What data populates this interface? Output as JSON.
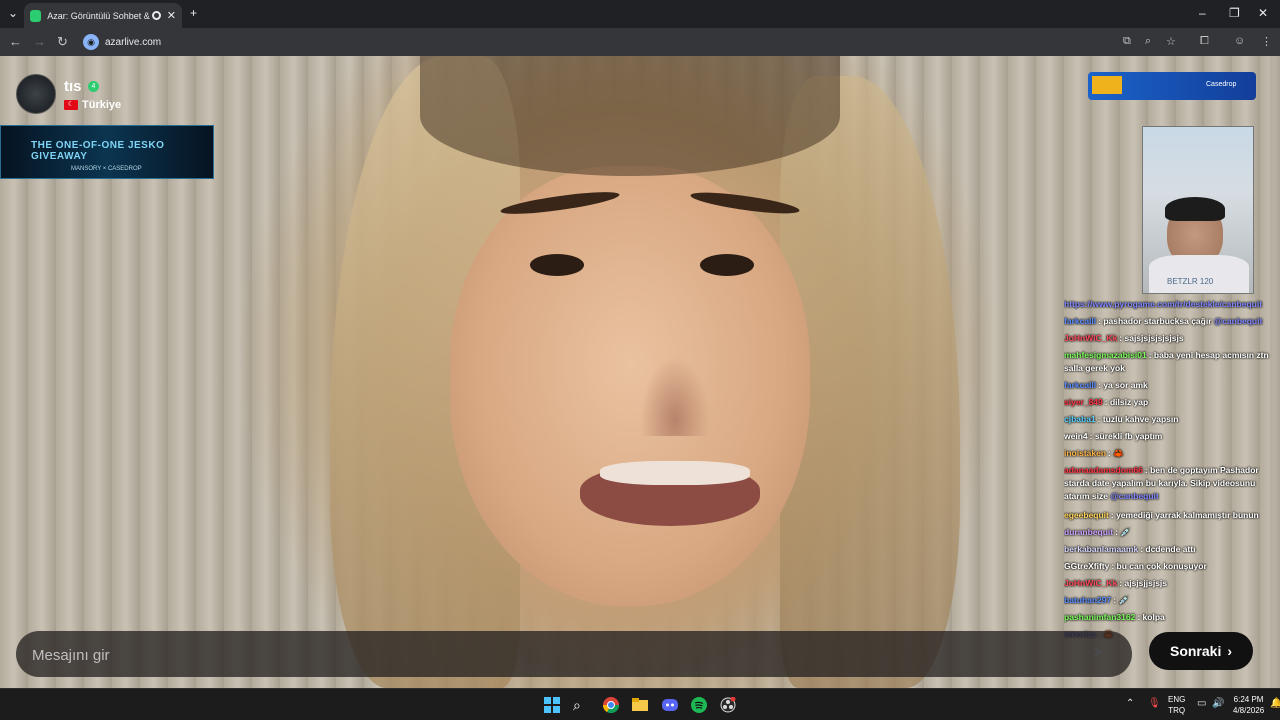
{
  "browser": {
    "tab_title": "Azar: Görüntülü Sohbet & Y",
    "url": "azarlive.com",
    "tab_favicon_color": "#2ecc71"
  },
  "stream": {
    "username": "tıs",
    "badge": "4",
    "country": "Türkiye",
    "banner_title": "THE ONE-OF-ONE JESKO GIVEAWAY",
    "banner_sub": "MANSORY × CASEDROP",
    "ad_text": "Casedrop",
    "cam_label": "BETZLR 120"
  },
  "chat": [
    {
      "name": "https://www.pyrogame.com/tr/destekle/canbequit",
      "text": "",
      "color": "#7f86ff"
    },
    {
      "name": "farkcalll",
      "text": "pashador starbucksa çağır",
      "mention": "@canbequit",
      "color": "#5a8cff"
    },
    {
      "name": "JoHnWiC_Kk",
      "text": "sajsjsjsjsjsjsjs",
      "color": "#ff4b5c"
    },
    {
      "name": "mahfesigmazabisi01",
      "text": "baba yeni hesap acmısın ztn salla gerek yok",
      "color": "#7cfc5c"
    },
    {
      "name": "farkcalll",
      "text": "ya sor amk",
      "color": "#5a8cff"
    },
    {
      "name": "siyer_849",
      "text": "dilsiz yap",
      "color": "#ff3344"
    },
    {
      "name": "cjbaba1",
      "text": "tuzlu kahve yapsın",
      "color": "#5ad0ff"
    },
    {
      "name": "wein4",
      "text": "sürekli fb yaptım",
      "color": "#ffffff"
    },
    {
      "name": "inoistaken",
      "text": "🦀",
      "color": "#ffb347"
    },
    {
      "name": "adanaadamsdom66",
      "text": "ben de goptayım Pashador starda date yapalım bu karıyla. Sikip videosunu atarım size",
      "mention": "@canbequit",
      "color": "#ff3344"
    },
    {
      "name": "egeebequit",
      "text": "yemediği yarrak kalmamıştır bunun",
      "color": "#ffd45a"
    },
    {
      "name": "duranbequit",
      "text": "💉",
      "color": "#c9a0ff"
    },
    {
      "name": "berkabanlamaamk",
      "text": "dcdende attı",
      "color": "#d7d7ff"
    },
    {
      "name": "GGtreXfifty",
      "text": "bu can çok konuşuyor",
      "color": "#ffffff"
    },
    {
      "name": "JoHnWiC_Kk",
      "text": "ajsjsjjsjsjs",
      "color": "#ff4b5c"
    },
    {
      "name": "batuhan297",
      "text": "💉",
      "color": "#5a8cff"
    },
    {
      "name": "pashanimfan3162",
      "text": "kolpa",
      "color": "#7cfc5c"
    },
    {
      "name": "emorizs",
      "text": "🦀",
      "color": "#7f86ff"
    }
  ],
  "input": {
    "placeholder": "Mesajını gir"
  },
  "next_button": "Sonraki",
  "taskbar": {
    "lang_top": "ENG",
    "lang_bottom": "TRQ",
    "time": "6:24 PM",
    "date": "4/8/2026"
  }
}
